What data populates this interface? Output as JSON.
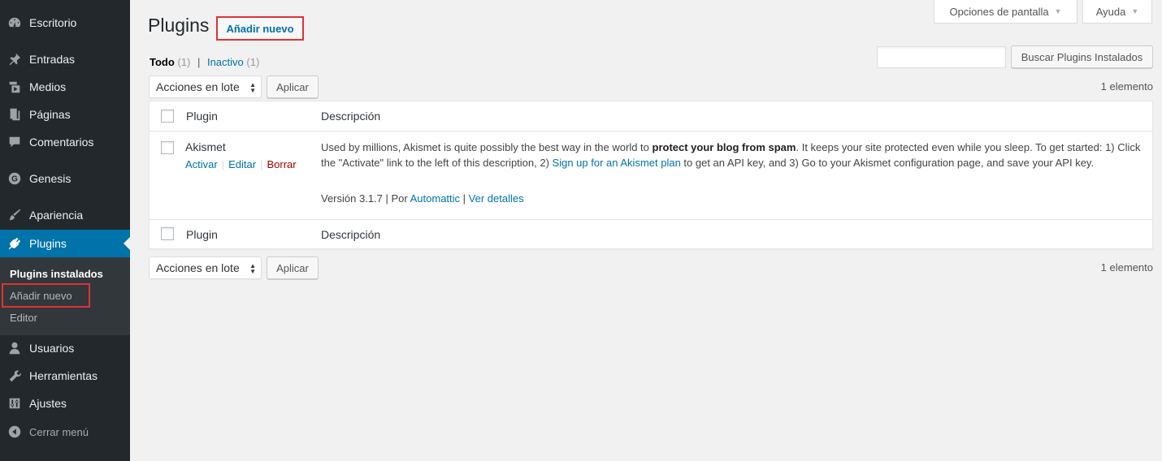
{
  "sidebar": {
    "items": [
      {
        "label": "Escritorio",
        "icon": "dashboard-icon"
      },
      {
        "label": "Entradas",
        "icon": "pin-icon"
      },
      {
        "label": "Medios",
        "icon": "media-icon"
      },
      {
        "label": "Páginas",
        "icon": "pages-icon"
      },
      {
        "label": "Comentarios",
        "icon": "comment-icon"
      },
      {
        "label": "Genesis",
        "icon": "genesis-icon"
      },
      {
        "label": "Apariencia",
        "icon": "brush-icon"
      },
      {
        "label": "Plugins",
        "icon": "plugin-icon"
      },
      {
        "label": "Usuarios",
        "icon": "user-icon"
      },
      {
        "label": "Herramientas",
        "icon": "wrench-icon"
      },
      {
        "label": "Ajustes",
        "icon": "settings-icon"
      }
    ],
    "submenu": [
      "Plugins instalados",
      "Añadir nuevo",
      "Editor"
    ],
    "collapse": "Cerrar menú"
  },
  "header": {
    "title": "Plugins",
    "add_new": "Añadir nuevo",
    "screen_options": "Opciones de pantalla",
    "help": "Ayuda"
  },
  "filters": {
    "all": "Todo",
    "all_count": "(1)",
    "separator": "|",
    "inactive": "Inactivo",
    "inactive_count": "(1)"
  },
  "search": {
    "value": "",
    "button": "Buscar Plugins Instalados"
  },
  "bulk": {
    "select": "Acciones en lote",
    "apply": "Aplicar",
    "count": "1 elemento"
  },
  "table": {
    "columns": [
      "Plugin",
      "Descripción"
    ],
    "plugin": {
      "name": "Akismet",
      "actions": [
        "Activar",
        "Editar",
        "Borrar"
      ],
      "desc_1": "Used by millions, Akismet is quite possibly the best way in the world to ",
      "desc_bold": "protect your blog from spam",
      "desc_2": ". It keeps your site protected even while you sleep. To get started: 1) Click the \"Activate\" link to the left of this description, 2) ",
      "desc_link": "Sign up for an Akismet plan",
      "desc_3": " to get an API key, and 3) Go to your Akismet configuration page, and save your API key.",
      "version": "Versión 3.1.7 | Por ",
      "author": "Automattic",
      "meta_sep": " | ",
      "details": "Ver detalles"
    }
  },
  "colors": {
    "sidebar_bg": "#23282d",
    "active_bg": "#0073aa",
    "link": "#0073aa",
    "highlight": "#dd3333"
  }
}
